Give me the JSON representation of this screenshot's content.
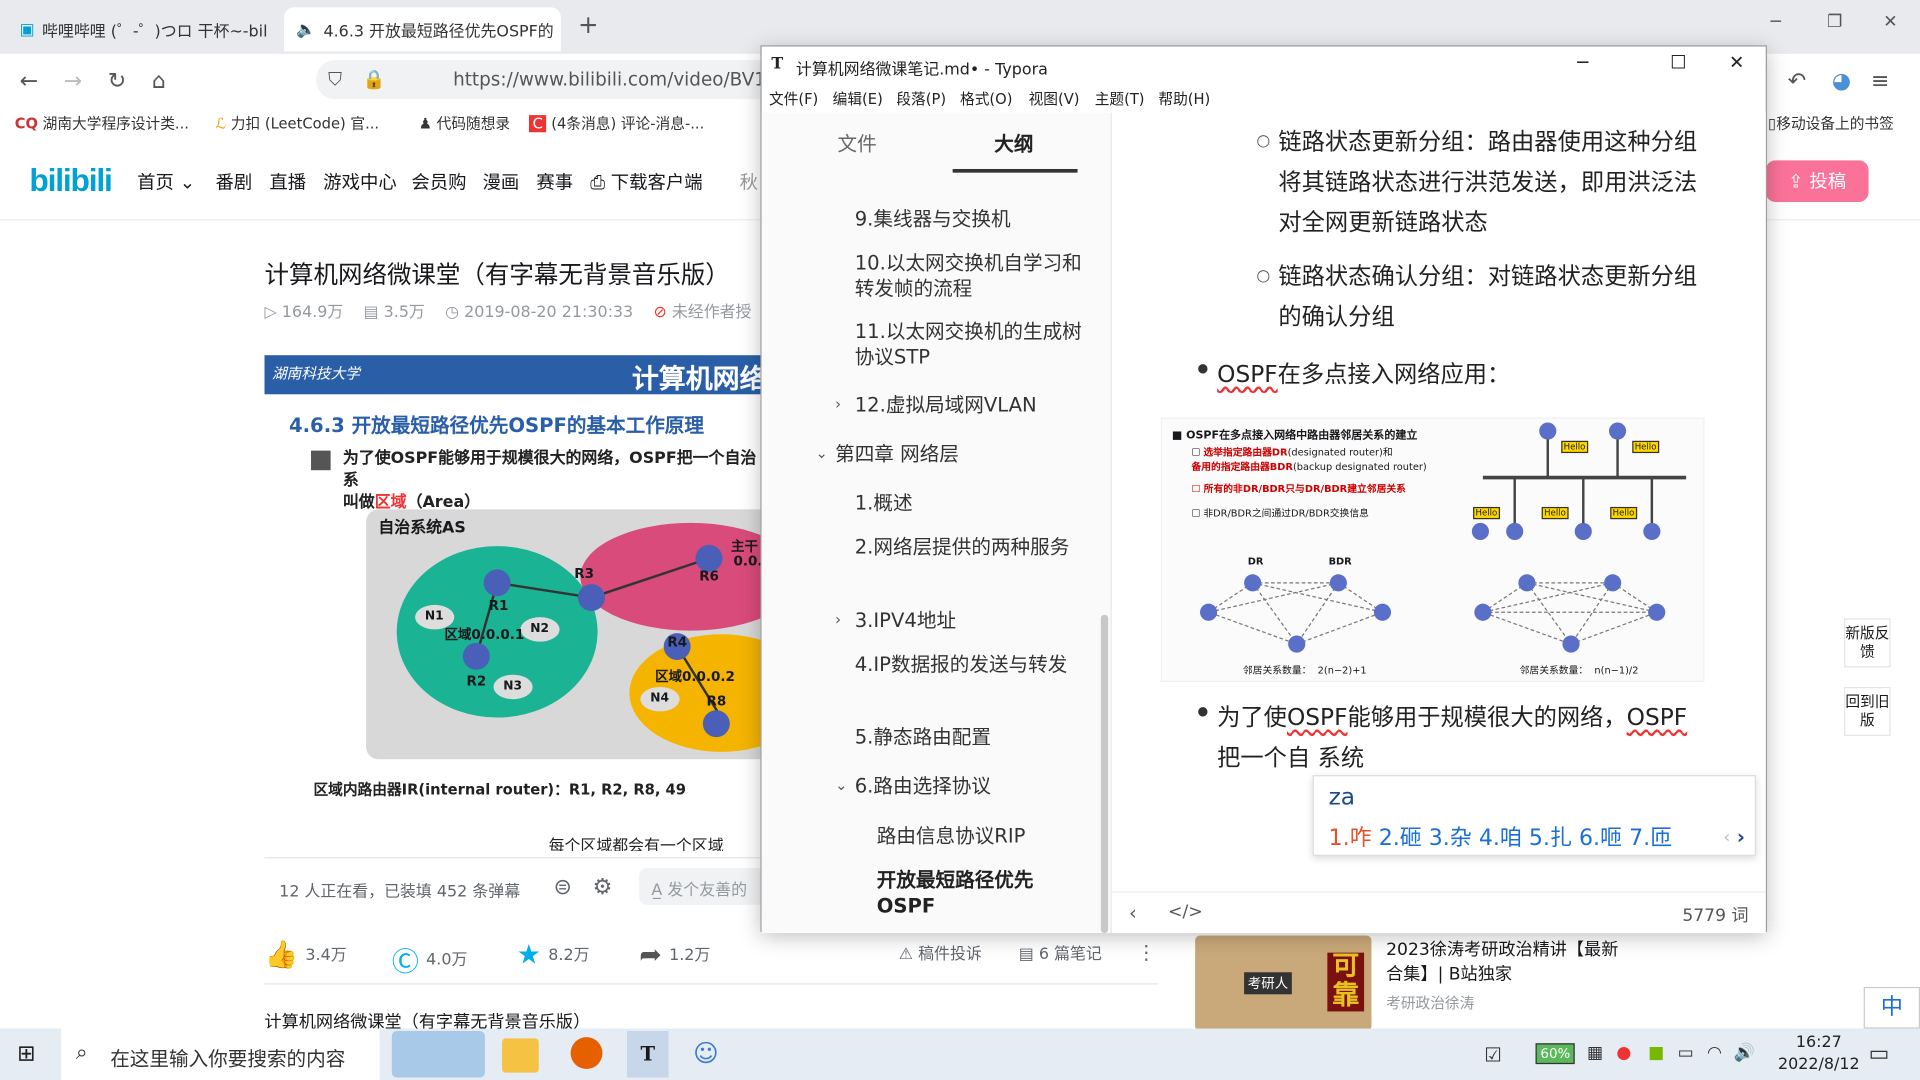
{
  "browser": {
    "tabs": [
      {
        "label": "哔哩哔哩 (゜-゜)つロ 干杯~-bil",
        "close": "×"
      },
      {
        "label": "4.6.3 开放最短路径优先OSPF的",
        "close": "×"
      }
    ],
    "new_tab": "+",
    "url": "https://www.bilibili.com/video/BV1c4",
    "bookmarks": [
      "湖南大学程序设计类...",
      "力扣 (LeetCode) 官...",
      "代码随想录",
      "(4条消息) 评论-消息-...",
      "移动设备上的书签"
    ]
  },
  "bilibili": {
    "logo": "bilibili",
    "nav": [
      "首页",
      "番剧",
      "直播",
      "游戏中心",
      "会员购",
      "漫画",
      "赛事",
      "下载客户端"
    ],
    "search_placeholder": "秋",
    "upload": "投稿",
    "video_title": "计算机网络微课堂（有字幕无背景音乐版）",
    "meta": {
      "views": "164.9万",
      "danmaku": "3.5万",
      "date": "2019-08-20 21:30:33",
      "notice": "未经作者授"
    },
    "slide": {
      "school": "湖南科技大学",
      "header": "计算机网络",
      "subtitle": "4.6.3 开放最短路径优先OSPF的基本工作原理",
      "bullet_a": "为了使OSPF能够用于规模很大的网络，OSPF把一个自治系",
      "bullet_b": "叫做",
      "bullet_red": "区域",
      "bullet_c": "（Area）",
      "as_label": "自治系统AS",
      "area1": "区域0.0.0.1",
      "area2": "区域0.0.0.2",
      "backbone": "主干",
      "backbone_id": "0.0.",
      "routers": [
        "R1",
        "R2",
        "R3",
        "R4",
        "R6",
        "R8"
      ],
      "networks": [
        "N1",
        "N2",
        "N3",
        "N4"
      ],
      "ir_text": "区域内路由器IR(internal router)：R1, R2, R8, 49",
      "subtitle_caption": "每个区域都会有一个区域"
    },
    "danmu": {
      "status": "12 人正在看，已装填 452 条弹幕",
      "placeholder": "发个友善的"
    },
    "actions": {
      "like": "3.4万",
      "coin": "4.0万",
      "fav": "8.2万",
      "share": "1.2万",
      "report": "稿件投诉",
      "notes": "6 篇笔记"
    },
    "desc_title": "计算机网络微课堂（有字幕无背景音乐版）",
    "rec": {
      "title": "2023徐涛考研政治精讲【最新合集】| B站独家",
      "author": "考研政治徐涛",
      "thumb_text": "考研人",
      "thumb_big": "可靠"
    },
    "side_buttons": [
      "新版反馈",
      "回到旧版"
    ]
  },
  "typora": {
    "title": "计算机网络微课笔记.md• - Typora",
    "menu": [
      "文件(F)",
      "编辑(E)",
      "段落(P)",
      "格式(O)",
      "视图(V)",
      "主题(T)",
      "帮助(H)"
    ],
    "sidebar_tabs": [
      "文件",
      "大纲"
    ],
    "outline": [
      "9.集线器与交换机",
      "10.以太网交换机自学习和转发帧的流程",
      "11.以太网交换机的生成树协议STP",
      "12.虚拟局域网VLAN",
      "第四章 网络层",
      "1.概述",
      "2.网络层提供的两种服务",
      "3.IPV4地址",
      "4.IP数据报的发送与转发",
      "5.静态路由配置",
      "6.路由选择协议",
      "路由信息协议RIP",
      "开放最短路径优先OSPF"
    ],
    "content": {
      "lsu": [
        "链路状态更新分组：路由器使用这种分组",
        "将其链路状态进行洪范发送，即用洪泛法",
        "对全网更新链路状态"
      ],
      "lsack": [
        "链路状态确认分组：对链路状态更新分组",
        "的确认分组"
      ],
      "multi_a": "OSPF",
      "multi_b": "在多点接入网络应用：",
      "fig": {
        "title": "OSPF在多点接入网络中路由器邻居关系的建立",
        "b1a": "选举指定路由器DR",
        "b1b": "(designated router)和",
        "b1c": "备用的指定路由器BDR",
        "b1d": "(backup designated router)",
        "b2": "所有的非DR/BDR只与DR/BDR建立邻居关系",
        "b3": "非DR/BDR之间通过DR/BDR交换信息",
        "hello": "Hello",
        "dr": "DR",
        "bdr": "BDR",
        "count_label": "邻居关系数量：",
        "count_a": "2(n−2)+1",
        "count_b": "n(n−1)/2"
      },
      "last_a": "为了使",
      "last_b": "OSPF",
      "last_c": "能够用于规模很大的网络，",
      "last_d": "OSPF",
      "last_e": "把一个自 系统"
    },
    "ime": {
      "pinyin": "za",
      "first": "1.咋",
      "rest": "2.砸 3.杂 4.咱 5.扎 6.咂 7.匝"
    },
    "word_count": "5779 词"
  },
  "taskbar": {
    "search_placeholder": "在这里输入你要搜索的内容",
    "battery": "60%",
    "time": "16:27",
    "date": "2022/8/12",
    "ime": "中"
  }
}
